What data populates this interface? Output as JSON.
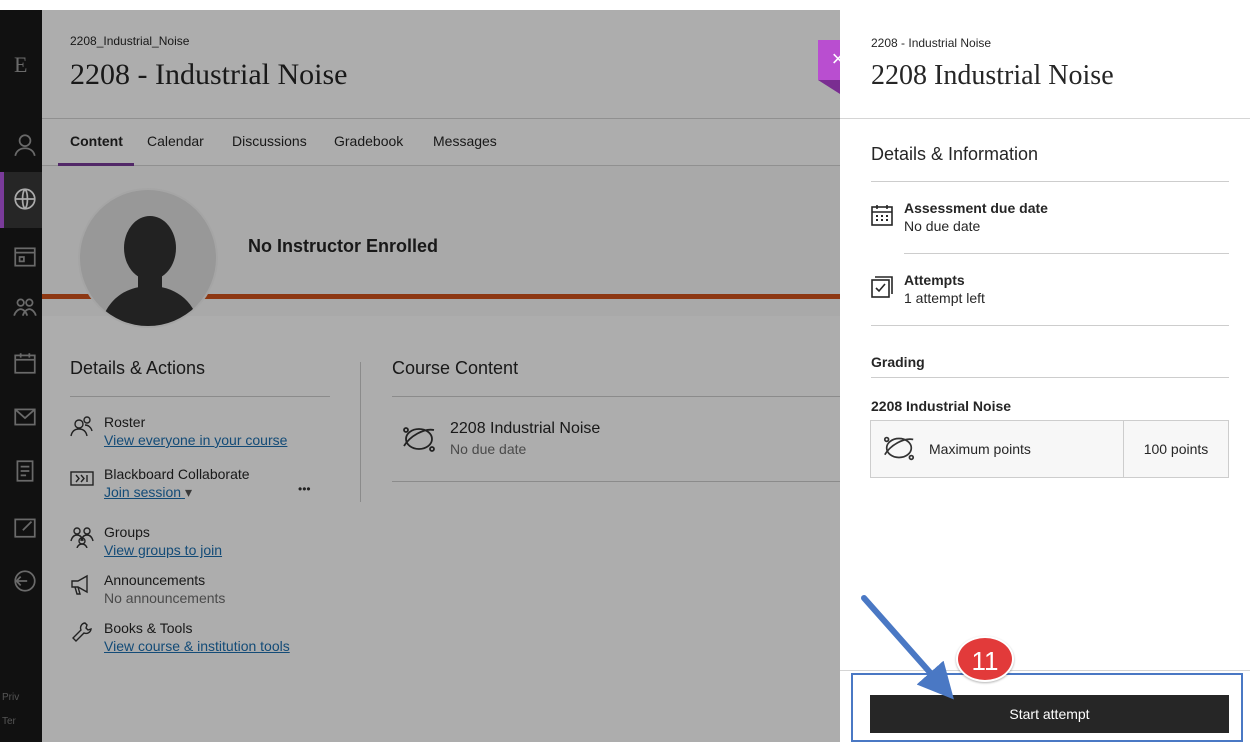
{
  "rail": {
    "letter": "E",
    "footer": [
      "Priv",
      "Ter"
    ]
  },
  "course": {
    "breadcrumb": "2208_Industrial_Noise",
    "title": "2208 - Industrial Noise",
    "tabs": [
      "Content",
      "Calendar",
      "Discussions",
      "Gradebook",
      "Messages"
    ],
    "active_tab": "Content",
    "instructor": "No Instructor Enrolled",
    "details_heading": "Details & Actions",
    "content_heading": "Course Content",
    "actions": [
      {
        "title": "Roster",
        "sub": "View everyone in your course",
        "icon": "roster-icon"
      },
      {
        "title": "Blackboard Collaborate",
        "sub": "Join session",
        "icon": "collaborate-icon"
      },
      {
        "title": "Groups",
        "sub": "View groups to join",
        "icon": "groups-icon"
      },
      {
        "title": "Announcements",
        "sub": "No announcements",
        "icon": "megaphone-icon"
      },
      {
        "title": "Books & Tools",
        "sub": "View course & institution tools",
        "icon": "wrench-icon"
      }
    ],
    "more_label": "•••",
    "content_item": {
      "title": "2208 Industrial Noise",
      "due": "No due date"
    }
  },
  "panel": {
    "breadcrumb": "2208 - Industrial Noise",
    "title": "2208 Industrial Noise",
    "close_label": "×",
    "section": "Details & Information",
    "due_label": "Assessment due date",
    "due_value": "No due date",
    "attempts_label": "Attempts",
    "attempts_value": "1 attempt left",
    "grading_heading": "Grading",
    "grading_item": "2208 Industrial Noise",
    "max_points_label": "Maximum points",
    "max_points_value": "100 points",
    "start_button": "Start attempt"
  },
  "annotation": {
    "step_number": "11",
    "colors": {
      "badge": "#e23a3a",
      "arrow": "#4a78c4",
      "accent": "#7a3b9a",
      "stripe": "#d0521b"
    }
  }
}
